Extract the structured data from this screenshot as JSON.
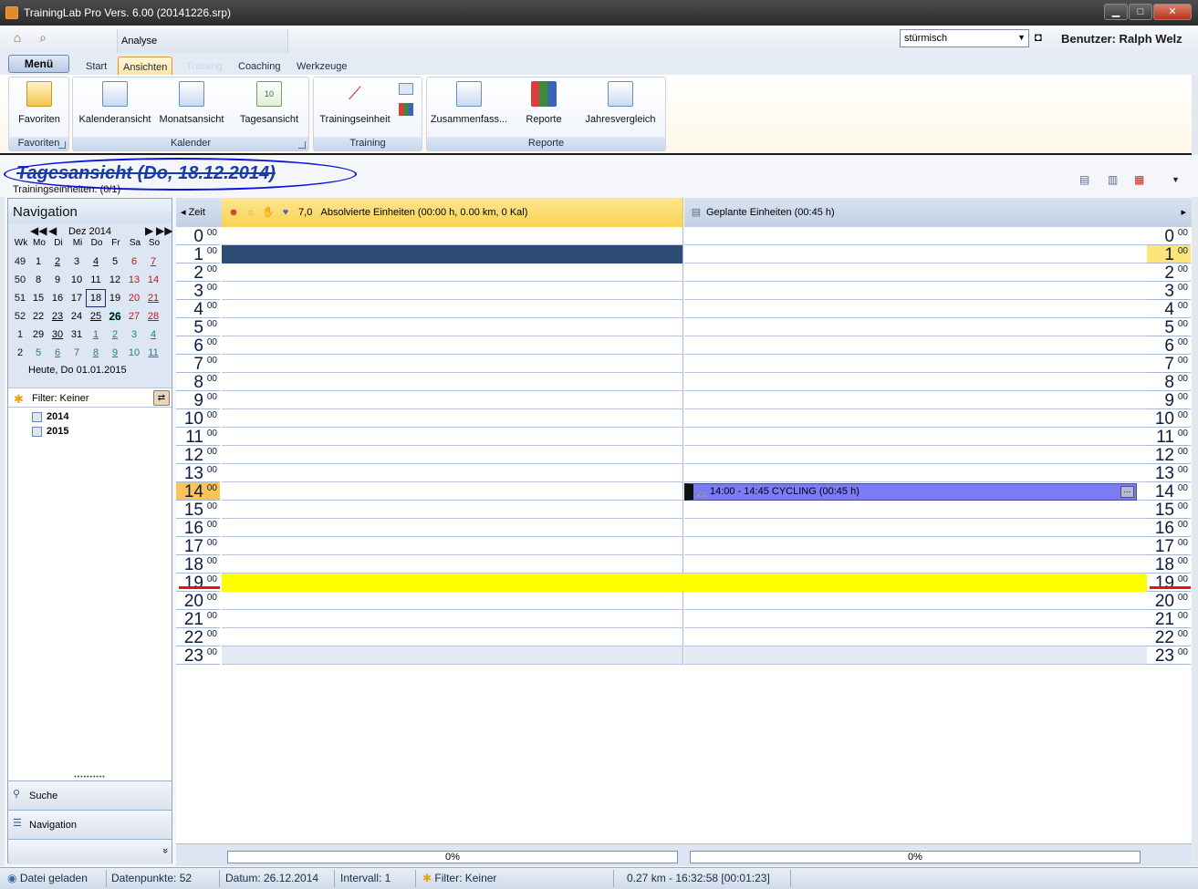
{
  "window": {
    "title": "TrainingLab Pro Vers. 6.00 (20141226.srp)",
    "min": "▁",
    "max": "□",
    "close": "✕"
  },
  "qat": {
    "analyse_tab": "Analyse",
    "weather_value": "stürmisch",
    "user_label": "Benutzer: Ralph Welz"
  },
  "tabs": {
    "menu": "Menü",
    "items": [
      "Start",
      "Ansichten",
      "Training",
      "Coaching",
      "Werkzeuge"
    ]
  },
  "ribbon": {
    "favoriten": {
      "button": "Favoriten",
      "group": "Favoriten"
    },
    "kalender": {
      "buttons": [
        "Kalenderansicht",
        "Monatsansicht",
        "Tagesansicht"
      ],
      "group": "Kalender",
      "day_icon_text": "10"
    },
    "training": {
      "button": "Trainingseinheit",
      "group": "Training"
    },
    "reporte": {
      "buttons": [
        "Zusammenfass...",
        "Reporte",
        "Jahresvergleich"
      ],
      "group": "Reporte"
    }
  },
  "header": {
    "title": "Tagesansicht (Do, 18.12.2014)",
    "subtitle": "Trainingseinheiten: (0/1)"
  },
  "navigation": {
    "title": "Navigation",
    "month": "Dez 2014",
    "weekday_headers": [
      "Wk",
      "Mo",
      "Di",
      "Mi",
      "Do",
      "Fr",
      "Sa",
      "So"
    ],
    "weeks": [
      {
        "wk": "49",
        "days": [
          "1",
          "2",
          "3",
          "4",
          "5",
          "6",
          "7"
        ]
      },
      {
        "wk": "50",
        "days": [
          "8",
          "9",
          "10",
          "11",
          "12",
          "13",
          "14"
        ]
      },
      {
        "wk": "51",
        "days": [
          "15",
          "16",
          "17",
          "18",
          "19",
          "20",
          "21"
        ]
      },
      {
        "wk": "52",
        "days": [
          "22",
          "23",
          "24",
          "25",
          "26",
          "27",
          "28"
        ]
      },
      {
        "wk": "1",
        "days": [
          "29",
          "30",
          "31",
          "1",
          "2",
          "3",
          "4"
        ]
      },
      {
        "wk": "2",
        "days": [
          "5",
          "6",
          "7",
          "8",
          "9",
          "10",
          "11"
        ]
      }
    ],
    "today_label": "Heute, Do 01.01.2015",
    "filter": "Filter: Keiner",
    "tree": [
      "2014",
      "2015"
    ],
    "buttons": [
      "Suche",
      "Navigation"
    ],
    "more": "»"
  },
  "grid": {
    "zeit_label": "Zeit",
    "abs_value": "7,0",
    "abs_header": "Absolvierte Einheiten (00:00 h, 0.00 km, 0 Kal)",
    "plan_header": "Geplante Einheiten (00:45 h)",
    "hours": [
      "0",
      "1",
      "2",
      "3",
      "4",
      "5",
      "6",
      "7",
      "8",
      "9",
      "10",
      "11",
      "12",
      "13",
      "14",
      "15",
      "16",
      "17",
      "18",
      "19",
      "20",
      "21",
      "22",
      "23"
    ],
    "minutes": "00",
    "event": "14:00 - 14:45 CYCLING (00:45 h)",
    "progress_abs": "0%",
    "progress_plan": "0%"
  },
  "status": {
    "loaded": "Datei geladen",
    "datapoints": "Datenpunkte: 52",
    "date": "Datum: 26.12.2014",
    "interval": "Intervall: 1",
    "filter": "Filter: Keiner",
    "gps": "0.27 km - 16:32:58 [00:01:23]"
  },
  "colors": {
    "event": "#7b7bf2",
    "highlight": "#ffff00",
    "dark_band": "#2e4d76",
    "annotation": "#0a14d8"
  }
}
